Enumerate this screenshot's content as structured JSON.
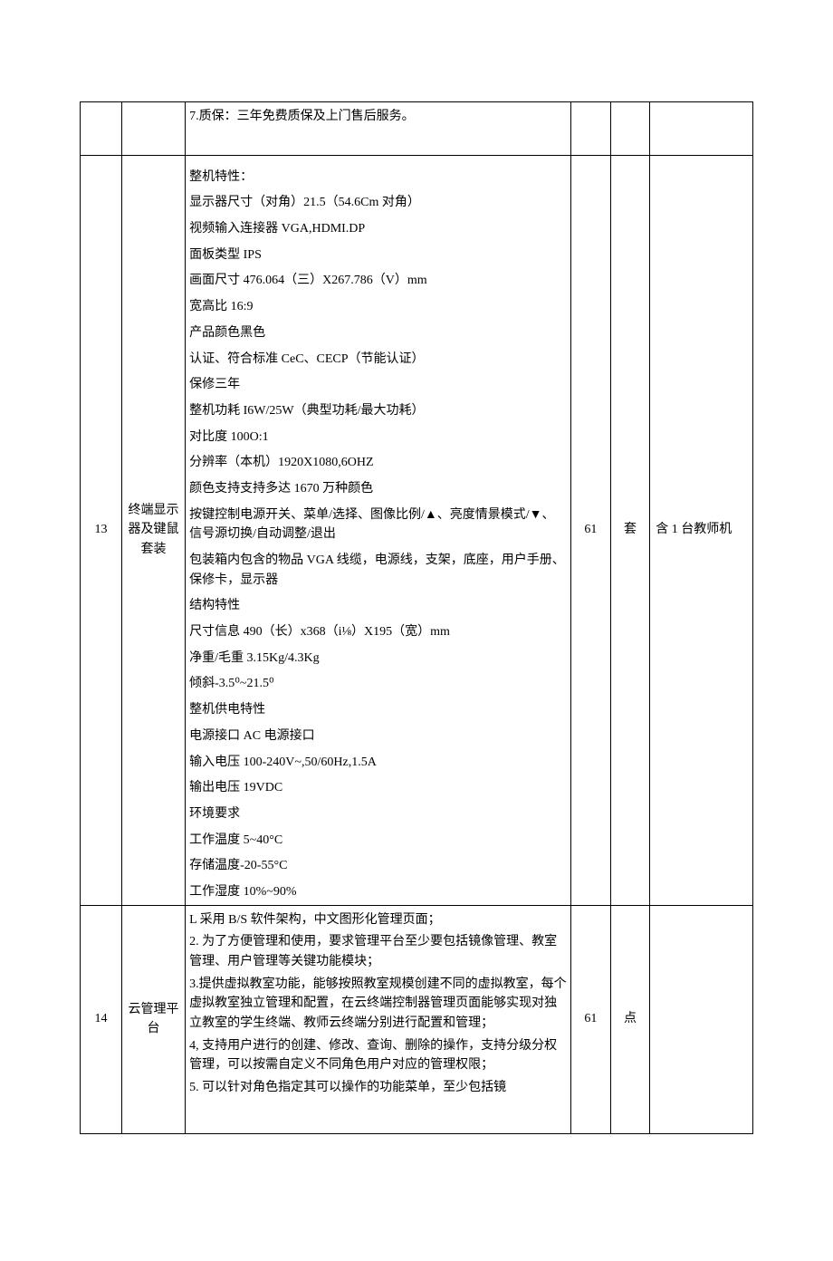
{
  "rows": [
    {
      "idx": "",
      "name": "",
      "spec": [
        "7.质保：三年免费质保及上门售后服务。"
      ],
      "qty": "",
      "unit": "",
      "note": ""
    },
    {
      "idx": "13",
      "name_lines": [
        "终端显示",
        "器及键鼠",
        "套装"
      ],
      "spec": [
        "整机特性：",
        "显示器尺寸（对角）21.5（54.6Cm 对角）",
        "视频输入连接器 VGA,HDMI.DP",
        "面板类型 IPS",
        "画面尺寸 476.064（三）X267.786（V）mm",
        "宽高比 16:9",
        "产品颜色黑色",
        "认证、符合标准 CeC、CECP（节能认证）",
        "保修三年",
        "整机功耗 I6W/25W（典型功耗/最大功耗）",
        "对比度 100O:1",
        "分辨率（本机）1920X1080,6OHZ",
        "颜色支持支持多达 1670 万种颜色",
        "按键控制电源开关、菜单/选择、图像比例/▲、亮度情景模式/▼、信号源切换/自动调整/退出",
        "包装箱内包含的物品 VGA 线缆，电源线，支架，底座，用户手册、保修卡，显示器",
        "结构特性",
        "尺寸信息 490（长）x368（i⅛）X195（宽）mm",
        "净重/毛重 3.15Kg/4.3Kg",
        "倾斜-3.5⁰~21.5⁰",
        "整机供电特性",
        "电源接口 AC 电源接口",
        "输入电压 100-240V~,50/60Hz,1.5A",
        "输出电压 19VDC",
        "环境要求",
        "工作温度 5~40°C",
        "存储温度-20-55°C",
        "工作湿度 10%~90%"
      ],
      "qty": "61",
      "unit": "套",
      "note": "含 1 台教师机"
    },
    {
      "idx": "14",
      "name_lines": [
        "云管理平",
        "台"
      ],
      "spec": [
        "L 采用 B/S 软件架构，中文图形化管理页面；",
        "2. 为了方便管理和使用，要求管理平台至少要包括镜像管理、教室管理、用户管理等关键功能模块；",
        "3.提供虚拟教室功能，能够按照教室规模创建不同的虚拟教室，每个虚拟教室独立管理和配置，在云终端控制器管理页面能够实现对独立教室的学生终端、教师云终端分别进行配置和管理；",
        "4, 支持用户进行的创建、修改、查询、删除的操作，支持分级分权管理，可以按需自定义不同角色用户对应的管理权限；",
        "5. 可以针对角色指定其可以操作的功能菜单，至少包括镜"
      ],
      "qty": "61",
      "unit": "点",
      "note": ""
    }
  ]
}
